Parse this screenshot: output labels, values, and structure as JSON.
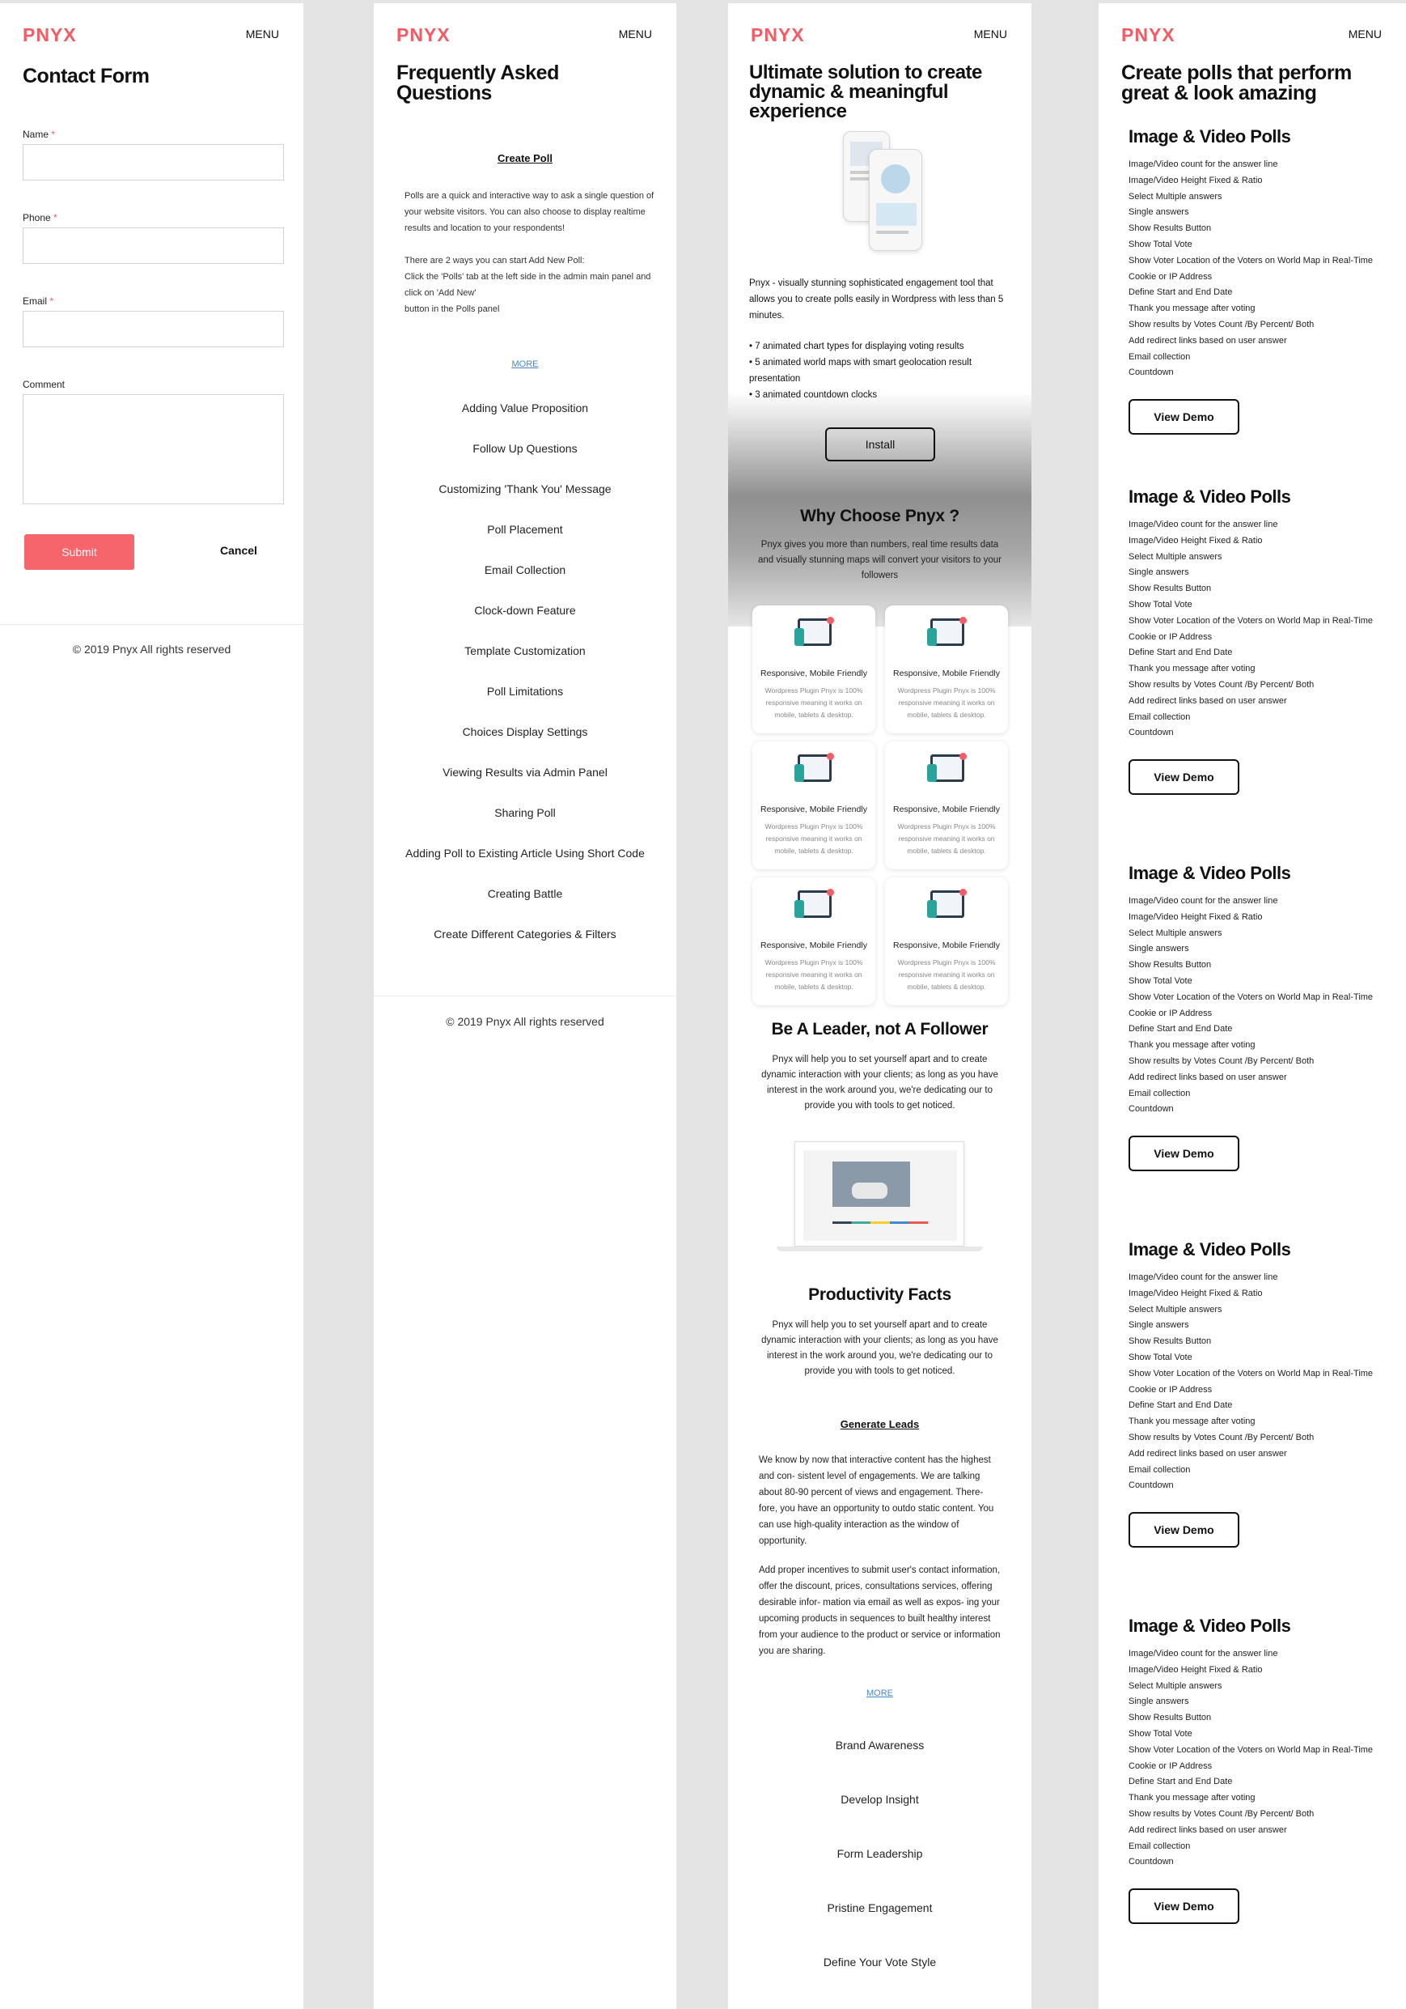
{
  "brand": {
    "logo": "PNYX",
    "menu": "MENU",
    "accent": "#f25c64"
  },
  "contact": {
    "title": "Contact Form",
    "fields": [
      {
        "label": "Name",
        "required": "*"
      },
      {
        "label": "Phone",
        "required": "*"
      },
      {
        "label": "Email",
        "required": "*"
      },
      {
        "label": "Comment",
        "required": ""
      }
    ],
    "submit": "Submit",
    "cancel": "Cancel",
    "copyright": "© 2019 Pnyx All rights reserved"
  },
  "faq": {
    "title_line1": "Frequently Asked",
    "title_line2": "Questions",
    "open_question": "Create Poll",
    "answer_p1": "Polls are a quick and interactive way to ask a single question of your website visitors. You can also choose to display realtime results and location to your respondents!",
    "answer_p2_l1": "There are 2 ways you can start Add New Poll:",
    "answer_p2_l2": "Click the 'Polls' tab at the left side in the admin main panel and click on 'Add New'",
    "answer_p2_l3": "button in the Polls panel",
    "more": "MORE",
    "questions": [
      "Adding Value Proposition",
      "Follow Up Questions",
      "Customizing 'Thank You' Message",
      "Poll Placement",
      "Email Collection",
      "Clock-down Feature",
      "Template Customization",
      "Poll Limitations",
      "Choices Display Settings",
      "Viewing Results via Admin Panel",
      "Sharing Poll",
      "Adding Poll to Existing Article Using Short Code",
      "Creating Battle",
      "Create Different Categories & Filters"
    ],
    "copyright": "© 2019 Pnyx All rights reserved"
  },
  "landing": {
    "title": "Ultimate solution to create dynamic & meaningful experience",
    "desc": "Pnyx - visually stunning sophisticated engagement tool that allows you to create polls easily in Wordpress with less than 5 minutes.",
    "bullets": [
      "• 7 animated chart types for displaying voting results",
      "• 5 animated world maps with smart geolocation result presentation",
      "• 3 animated countdown clocks"
    ],
    "install": "Install",
    "why_title": "Why Choose Pnyx ?",
    "why_text": "Pnyx gives you more than numbers, real time results data and visually stunning maps will convert your visitors to your followers",
    "cards": [
      {
        "title": "Responsive, Mobile Friendly",
        "desc": "Wordpress Plugin Pnyx is 100% responsive meaning it works on mobile, tablets & desktop."
      },
      {
        "title": "Responsive, Mobile Friendly",
        "desc": "Wordpress Plugin Pnyx is 100% responsive meaning it works on mobile, tablets & desktop."
      },
      {
        "title": "Responsive, Mobile Friendly",
        "desc": "Wordpress Plugin Pnyx is 100% responsive meaning it works on mobile, tablets & desktop."
      },
      {
        "title": "Responsive, Mobile Friendly",
        "desc": "Wordpress Plugin Pnyx is 100% responsive meaning it works on mobile, tablets & desktop."
      },
      {
        "title": "Responsive, Mobile Friendly",
        "desc": "Wordpress Plugin Pnyx is 100% responsive meaning it works on mobile, tablets & desktop."
      },
      {
        "title": "Responsive, Mobile Friendly",
        "desc": "Wordpress Plugin Pnyx is 100% responsive meaning it works on mobile, tablets & desktop."
      }
    ],
    "leader_title": "Be A Leader, not A Follower",
    "leader_text": "Pnyx will help you to set yourself apart and to create dynamic interaction with your clients; as long as you have interest in the work around you, we're dedicating our to provide you with tools to get noticed.",
    "facts_title": "Productivity Facts",
    "facts_text": "Pnyx will help you to set yourself apart and to create dynamic interaction with your clients; as long as you have interest in the work around you, we're dedicating our to provide you with tools to get noticed.",
    "leads_title": "Generate Leads",
    "leads_p1": "We know by now that interactive content has the highest and con- sistent level of engagements. We are talking about 80-90 percent of views and engagement. There- fore, you have an opportunity to outdo static content. You can use high-quality interaction as the window of opportunity.",
    "leads_p2": "Add proper incentives to submit user's contact information, offer the discount, prices, consultations services, offering desirable infor- mation via email as well as expos- ing your upcoming products in sequences to built healthy interest from your audience to the product or service or information you are sharing.",
    "more": "MORE",
    "facts_items": [
      "Brand Awareness",
      "Develop Insight",
      "Form Leadership",
      "Pristine Engagement",
      "Define Your Vote Style"
    ]
  },
  "polls": {
    "title": "Create polls that perform great & look amazing",
    "section_title": "Image & Video Polls",
    "features": [
      "Image/Video count for the answer line",
      "Image/Video Height  Fixed & Ratio",
      "Select Multiple answers",
      "Single answers",
      "Show Results Button",
      "Show Total Vote",
      "Show Voter Location of the Voters on World Map in Real-Time",
      "Cookie or IP Address",
      "Define Start and End Date",
      "Thank you message after voting",
      "Show results by Votes Count /By Percent/ Both",
      "Add redirect links based on user answer",
      "Email collection",
      "Countdown"
    ],
    "button": "View Demo"
  }
}
